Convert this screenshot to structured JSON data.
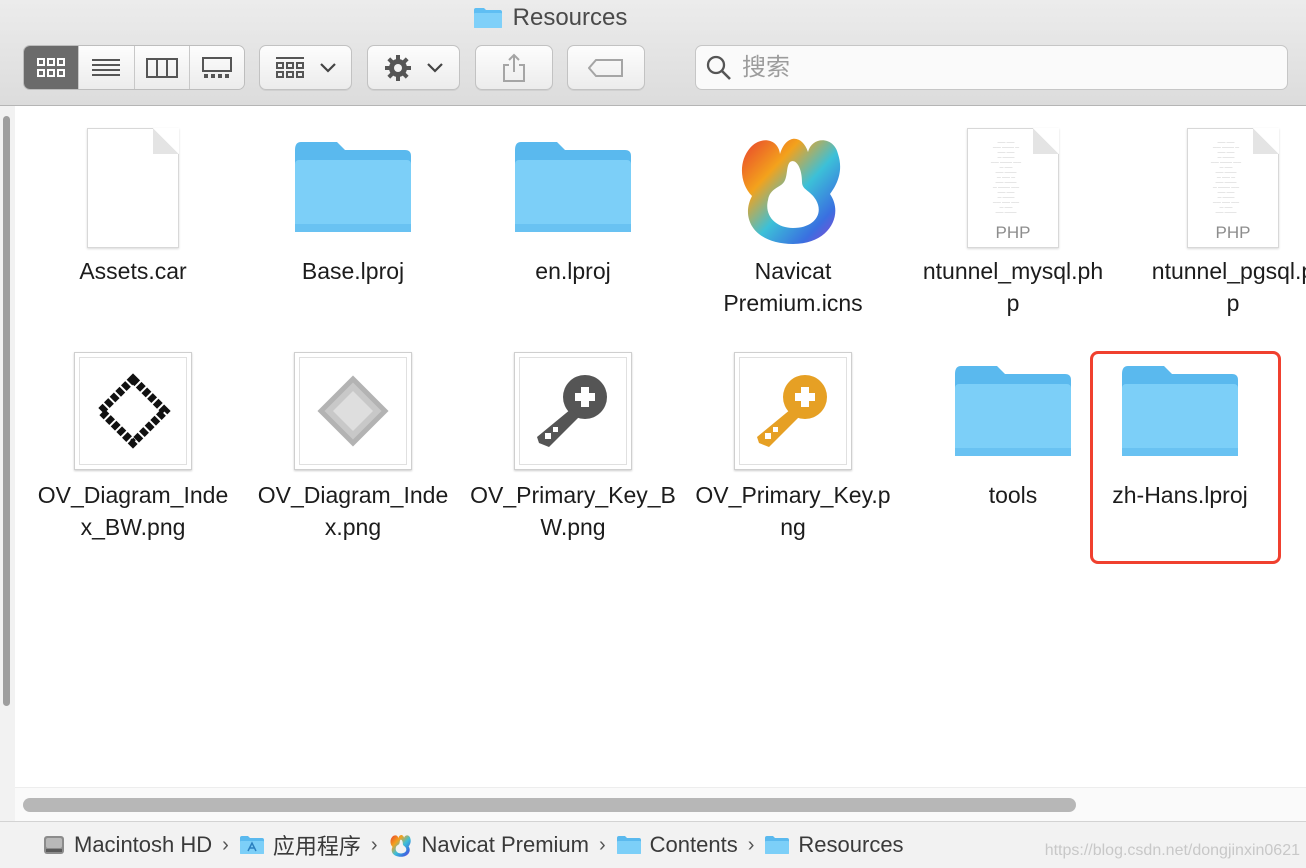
{
  "window": {
    "title": "Resources"
  },
  "toolbar": {
    "view_modes": [
      "icon-view",
      "list-view",
      "column-view",
      "gallery-view"
    ],
    "active_view": "icon-view",
    "search_placeholder": "搜索"
  },
  "items": [
    {
      "name": "Assets.car",
      "kind": "file"
    },
    {
      "name": "Base.lproj",
      "kind": "folder"
    },
    {
      "name": "en.lproj",
      "kind": "folder"
    },
    {
      "name": "Navicat Premium.icns",
      "kind": "icns"
    },
    {
      "name": "ntunnel_mysql.php",
      "kind": "php"
    },
    {
      "name": "ntunnel_pgsql.php",
      "kind": "php"
    },
    {
      "name": "OV_Diagram_Index_BW.png",
      "kind": "png-diagram-bw"
    },
    {
      "name": "OV_Diagram_Index.png",
      "kind": "png-diagram"
    },
    {
      "name": "OV_Primary_Key_BW.png",
      "kind": "png-key-bw"
    },
    {
      "name": "OV_Primary_Key.png",
      "kind": "png-key"
    },
    {
      "name": "tools",
      "kind": "folder"
    },
    {
      "name": "zh-Hans.lproj",
      "kind": "folder",
      "highlighted": true
    }
  ],
  "labels": {
    "i0": "Assets.car",
    "i1": "Base.lproj",
    "i2": "en.lproj",
    "i3a": "Navicat",
    "i3b": "Premium.icns",
    "i4a": "ntunnel_mysql.ph",
    "i4b": "p",
    "i5a": "ntunnel_pgsql.p",
    "i5b": "p",
    "i6a": "OV_Diagram_Inde",
    "i6b": "x_BW.png",
    "i7a": "OV_Diagram_Inde",
    "i7b": "x.png",
    "i8a": "OV_Primary_Key_B",
    "i8b": "W.png",
    "i9a": "OV_Primary_Key.p",
    "i9b": "ng",
    "i10": "tools",
    "i11": "zh-Hans.lproj"
  },
  "php_tag": "PHP",
  "pathbar": {
    "crumbs": [
      "Macintosh HD",
      "应用程序",
      "Navicat Premium",
      "Contents",
      "Resources"
    ],
    "separator": "›"
  },
  "watermark": "https://blog.csdn.net/dongjinxin0621",
  "colors": {
    "folder": "#6ec9f7",
    "highlight": "#f0402f",
    "selected_view": "#6b6b6b"
  }
}
